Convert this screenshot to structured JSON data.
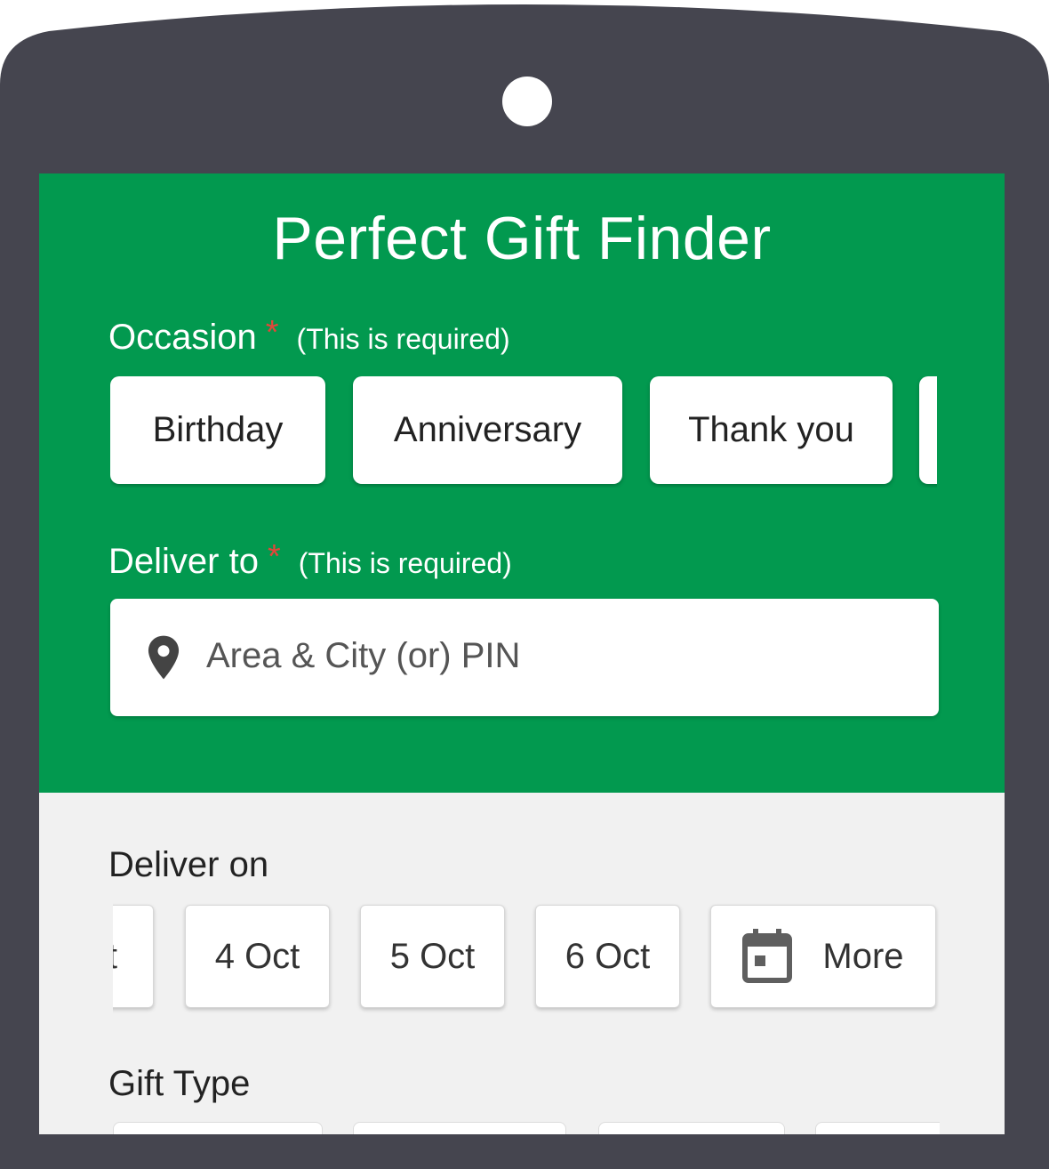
{
  "app": {
    "title": "Perfect Gift Finder"
  },
  "occasion": {
    "label": "Occasion",
    "required_mark": "*",
    "required_note": "(This is required)",
    "options": [
      "Birthday",
      "Anniversary",
      "Thank you",
      ""
    ]
  },
  "deliver_to": {
    "label": "Deliver to",
    "required_mark": "*",
    "required_note": "(This is required)",
    "placeholder": "Area & City (or) PIN",
    "icon": "location-pin-icon"
  },
  "deliver_on": {
    "label": "Deliver on",
    "dates": [
      "t",
      "4 Oct",
      "5 Oct",
      "6 Oct"
    ],
    "more_label": "More",
    "more_icon": "calendar-icon"
  },
  "gift_type": {
    "label": "Gift Type"
  },
  "colors": {
    "device": "#45454f",
    "brand_green": "#02994f",
    "required_star": "#e2463a",
    "panel_bg": "#f1f1f1"
  }
}
